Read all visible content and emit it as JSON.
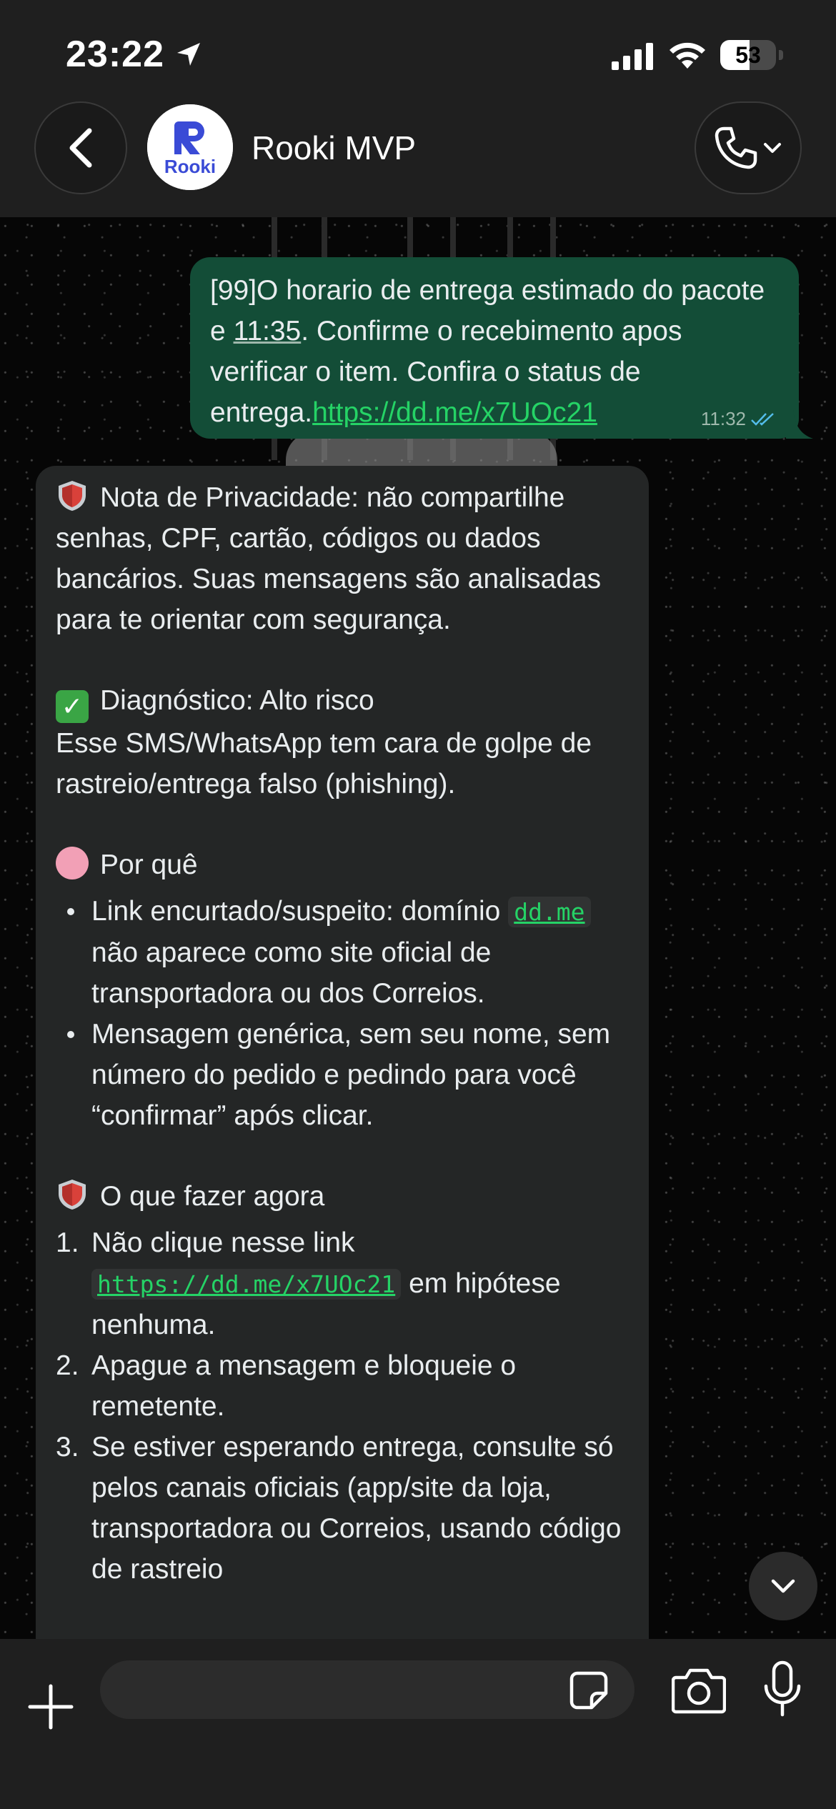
{
  "status_bar": {
    "time": "23:22",
    "battery": "53",
    "battery_level": 0.53
  },
  "header": {
    "contact_name": "Rooki MVP",
    "avatar_text": "Rooki",
    "avatar_letter": "R"
  },
  "messages": {
    "outgoing": {
      "text_before": "[99]O horario de entrega estimado do pacote e ",
      "time_underlined": "11:35",
      "text_after": ". Confirme o recebimento apos verificar o item. Confira o status de entrega.",
      "link": "https://dd.me/x7UOc21",
      "timestamp": "11:32"
    },
    "incoming": {
      "privacy": "Nota de Privacidade: não compartilhe senhas, CPF, cartão, códigos ou dados bancários. Suas mensagens são analisadas para te orientar com segurança.",
      "diagnosis_title": "Diagnóstico: Alto risco",
      "diagnosis_text": "Esse SMS/WhatsApp tem cara de golpe de rastreio/entrega falso (phishing).",
      "why_title": "Por quê",
      "why_1a": "Link encurtado/suspeito: domínio ",
      "why_1_code": "dd.me",
      "why_1b": " não aparece como site oficial de transportadora ou dos Correios.",
      "why_2": "Mensagem genérica, sem seu nome, sem número do pedido e pedindo para você “confirmar” após clicar.",
      "todo_title": "O que fazer agora",
      "todo_1a": "Não clique nesse link ",
      "todo_1_code": "https://dd.me/x7UOc21",
      "todo_1b": " em hipótese nenhuma.",
      "todo_2": "Apague a mensagem e bloqueie o remetente.",
      "todo_3": "Se estiver esperando entrega, consulte só pelos canais oficiais (app/site da loja, transportadora ou Correios, usando código de rastreio",
      "n1": "1.",
      "n2": "2.",
      "n3": "3."
    }
  },
  "input_bar": {
    "placeholder": ""
  },
  "icons": {
    "back": "chevron-left-icon",
    "call": "phone-icon",
    "plus": "plus-icon",
    "sticker": "sticker-icon",
    "camera": "camera-icon",
    "mic": "microphone-icon",
    "scroll": "chevron-down-icon"
  },
  "colors": {
    "outgoing_bubble": "#134d37",
    "incoming_bubble": "#242626",
    "link_green": "#25d366",
    "read_ticks": "#53bdeb"
  }
}
